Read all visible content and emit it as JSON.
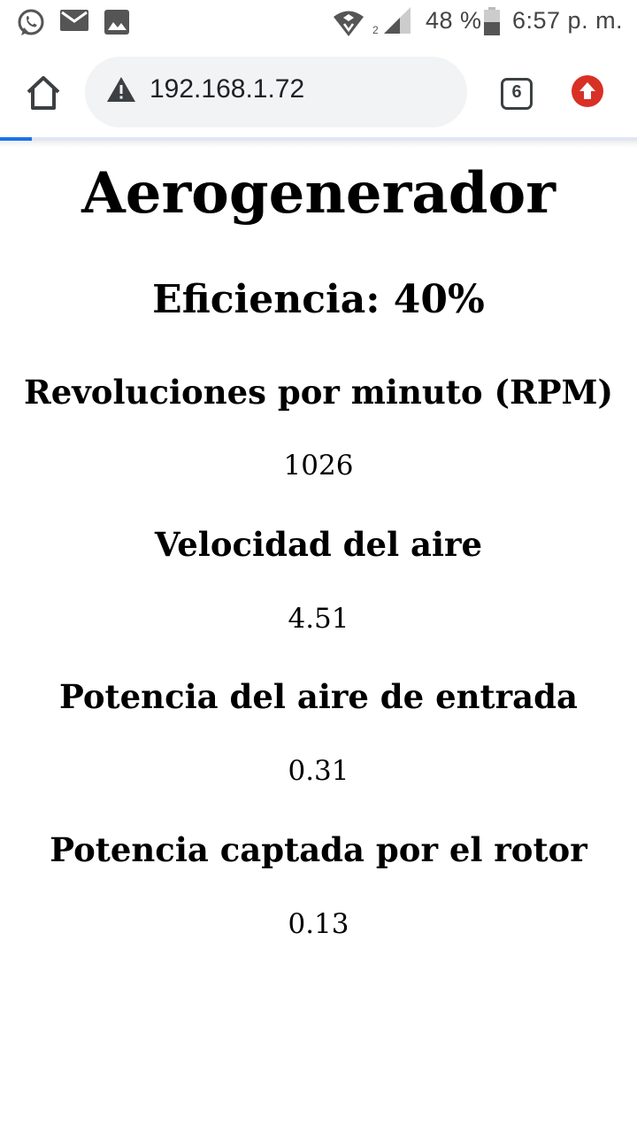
{
  "status_bar": {
    "battery_percent": "48 %",
    "time": "6:57 p. m.",
    "sim_slot": "2",
    "icons": [
      "whatsapp-icon",
      "mail-icon",
      "image-icon",
      "wifi-icon",
      "signal-icon",
      "battery-icon"
    ]
  },
  "browser": {
    "url": "192.168.1.72",
    "tab_count": "6",
    "page_load_progress": 0.05,
    "icons": [
      "home-icon",
      "warning-icon",
      "tabs-icon",
      "update-icon"
    ],
    "colors": {
      "url_bar_bg": "#f1f3f4",
      "progress": "#1a73e8",
      "update_button": "#d93025"
    }
  },
  "page": {
    "title": "Aerogenerador",
    "efficiency": "Eficiencia: 40%",
    "metrics": [
      {
        "label": "Revoluciones por minuto (RPM)",
        "value": "1026"
      },
      {
        "label": "Velocidad del aire",
        "value": "4.51"
      },
      {
        "label": "Potencia del aire de entrada",
        "value": "0.31"
      },
      {
        "label": "Potencia captada por el rotor",
        "value": "0.13"
      }
    ]
  }
}
